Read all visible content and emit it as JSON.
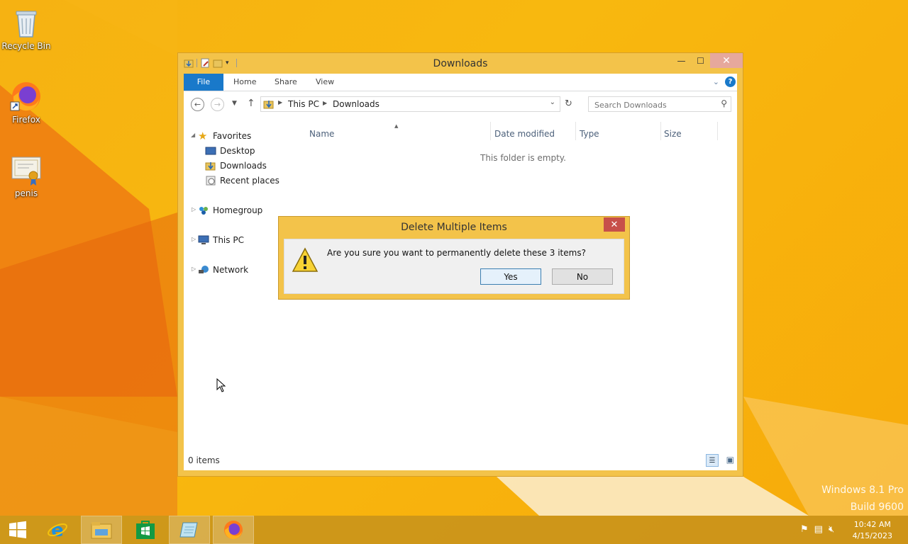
{
  "desktop": {
    "icons": [
      {
        "label": "Recycle Bin"
      },
      {
        "label": "Firefox"
      },
      {
        "label": "penis"
      }
    ]
  },
  "explorer": {
    "title": "Downloads",
    "tabs": {
      "file": "File",
      "home": "Home",
      "share": "Share",
      "view": "View"
    },
    "breadcrumb": [
      "This PC",
      "Downloads"
    ],
    "search_placeholder": "Search Downloads",
    "nav": {
      "favorites": "Favorites",
      "desktop": "Desktop",
      "downloads": "Downloads",
      "recent": "Recent places",
      "homegroup": "Homegroup",
      "thispc": "This PC",
      "network": "Network"
    },
    "columns": {
      "name": "Name",
      "date_modified": "Date modified",
      "type": "Type",
      "size": "Size"
    },
    "empty_text": "This folder is empty.",
    "status": "0 items"
  },
  "dialog": {
    "title": "Delete Multiple Items",
    "message": "Are you sure you want to permanently delete these 3 items?",
    "yes": "Yes",
    "no": "No"
  },
  "taskbar": {
    "time": "10:42 AM",
    "date": "4/15/2023"
  },
  "watermark": {
    "line1": "Windows 8.1 Pro",
    "line2": "Build 9600"
  },
  "colors": {
    "wallpaper": "#f6b212",
    "window_frame": "#f3c34a",
    "file_tab": "#1979ca",
    "close_button": "#c7504a"
  }
}
